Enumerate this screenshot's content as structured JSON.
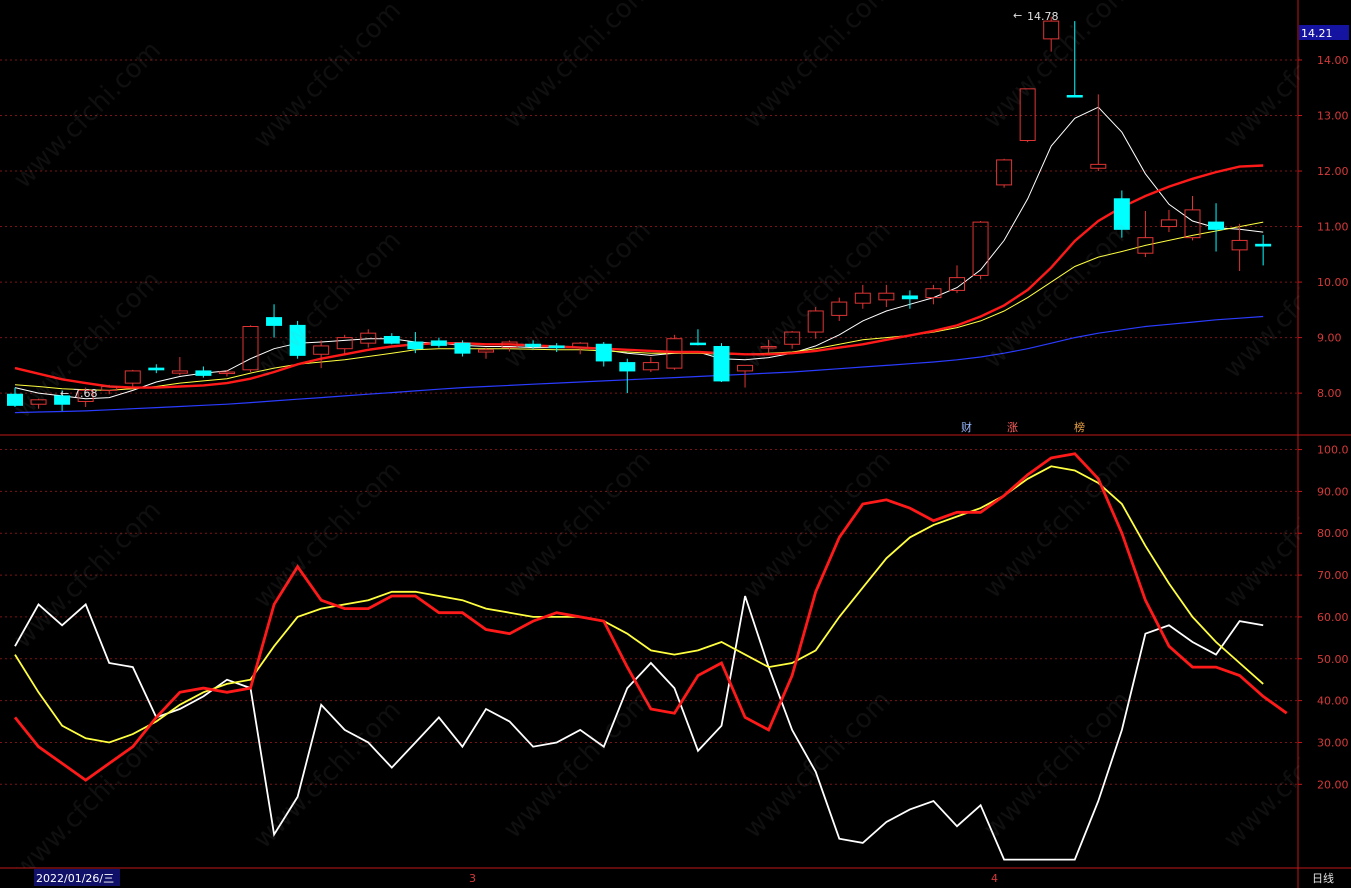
{
  "watermark": "www.cfchi.com",
  "colors": {
    "up": "#e03434",
    "down": "#00ffff",
    "grid": "#7a1414",
    "frame": "#c01818",
    "axis_text": "#d43a3a",
    "ma5": "#ffffff",
    "ma10": "#ffff40",
    "ma20": "#ff1a1a",
    "ma60": "#2a3cff"
  },
  "price_panel": {
    "current_price_tag": "14.21",
    "high_marker": "14.78",
    "low_marker": "7.68",
    "y_ticks": [
      "14.00",
      "13.00",
      "12.00",
      "11.00",
      "10.00",
      "9.00",
      "8.00"
    ],
    "events": [
      {
        "label": "财",
        "color": "#9ab8ff"
      },
      {
        "label": "涨",
        "color": "#ff6060"
      },
      {
        "label": "榜",
        "color": "#e8a040"
      }
    ]
  },
  "indicator_panel": {
    "y_ticks": [
      "100.0",
      "90.00",
      "80.00",
      "70.00",
      "60.00",
      "50.00",
      "40.00",
      "30.00",
      "20.00"
    ]
  },
  "footer": {
    "date_label": "2022/01/26/三",
    "month_marks": [
      "3",
      "4"
    ],
    "period_label": "日线"
  },
  "chart_data": [
    {
      "type": "candlestick",
      "ylim": [
        7.3,
        14.9
      ],
      "candles": [
        {
          "o": 7.98,
          "h": 8.1,
          "l": 7.75,
          "c": 7.78
        },
        {
          "o": 7.8,
          "h": 7.9,
          "l": 7.72,
          "c": 7.88
        },
        {
          "o": 7.95,
          "h": 8.05,
          "l": 7.68,
          "c": 7.8
        },
        {
          "o": 7.85,
          "h": 8.1,
          "l": 7.75,
          "c": 8.05
        },
        {
          "o": 8.05,
          "h": 8.15,
          "l": 7.98,
          "c": 8.12
        },
        {
          "o": 8.18,
          "h": 8.42,
          "l": 8.1,
          "c": 8.4
        },
        {
          "o": 8.45,
          "h": 8.52,
          "l": 8.36,
          "c": 8.42
        },
        {
          "o": 8.36,
          "h": 8.65,
          "l": 8.32,
          "c": 8.4
        },
        {
          "o": 8.4,
          "h": 8.48,
          "l": 8.28,
          "c": 8.32
        },
        {
          "o": 8.36,
          "h": 8.42,
          "l": 8.3,
          "c": 8.38
        },
        {
          "o": 8.42,
          "h": 9.22,
          "l": 8.38,
          "c": 9.2
        },
        {
          "o": 9.36,
          "h": 9.6,
          "l": 9.0,
          "c": 9.22
        },
        {
          "o": 9.22,
          "h": 9.3,
          "l": 8.62,
          "c": 8.68
        },
        {
          "o": 8.7,
          "h": 8.95,
          "l": 8.45,
          "c": 8.85
        },
        {
          "o": 8.8,
          "h": 9.05,
          "l": 8.7,
          "c": 9.0
        },
        {
          "o": 8.9,
          "h": 9.15,
          "l": 8.82,
          "c": 9.08
        },
        {
          "o": 9.02,
          "h": 9.08,
          "l": 8.88,
          "c": 8.9
        },
        {
          "o": 8.92,
          "h": 9.1,
          "l": 8.72,
          "c": 8.8
        },
        {
          "o": 8.94,
          "h": 9.0,
          "l": 8.82,
          "c": 8.86
        },
        {
          "o": 8.9,
          "h": 8.95,
          "l": 8.66,
          "c": 8.72
        },
        {
          "o": 8.74,
          "h": 8.82,
          "l": 8.62,
          "c": 8.78
        },
        {
          "o": 8.82,
          "h": 8.95,
          "l": 8.75,
          "c": 8.92
        },
        {
          "o": 8.88,
          "h": 8.95,
          "l": 8.8,
          "c": 8.84
        },
        {
          "o": 8.85,
          "h": 8.9,
          "l": 8.74,
          "c": 8.82
        },
        {
          "o": 8.82,
          "h": 8.92,
          "l": 8.7,
          "c": 8.9
        },
        {
          "o": 8.88,
          "h": 8.92,
          "l": 8.48,
          "c": 8.58
        },
        {
          "o": 8.55,
          "h": 8.62,
          "l": 8.0,
          "c": 8.4
        },
        {
          "o": 8.42,
          "h": 8.65,
          "l": 8.38,
          "c": 8.55
        },
        {
          "o": 8.45,
          "h": 9.05,
          "l": 8.42,
          "c": 8.98
        },
        {
          "o": 8.9,
          "h": 9.15,
          "l": 8.86,
          "c": 8.88
        },
        {
          "o": 8.84,
          "h": 8.9,
          "l": 8.2,
          "c": 8.22
        },
        {
          "o": 8.4,
          "h": 8.5,
          "l": 8.1,
          "c": 8.5
        },
        {
          "o": 8.82,
          "h": 8.96,
          "l": 8.7,
          "c": 8.84
        },
        {
          "o": 8.88,
          "h": 9.12,
          "l": 8.8,
          "c": 9.1
        },
        {
          "o": 9.1,
          "h": 9.55,
          "l": 8.98,
          "c": 9.48
        },
        {
          "o": 9.4,
          "h": 9.72,
          "l": 9.3,
          "c": 9.64
        },
        {
          "o": 9.62,
          "h": 9.95,
          "l": 9.52,
          "c": 9.8
        },
        {
          "o": 9.68,
          "h": 9.95,
          "l": 9.55,
          "c": 9.8
        },
        {
          "o": 9.75,
          "h": 9.85,
          "l": 9.52,
          "c": 9.7
        },
        {
          "o": 9.72,
          "h": 9.95,
          "l": 9.6,
          "c": 9.88
        },
        {
          "o": 9.85,
          "h": 10.3,
          "l": 9.8,
          "c": 10.08
        },
        {
          "o": 10.12,
          "h": 11.1,
          "l": 10.05,
          "c": 11.08
        },
        {
          "o": 11.75,
          "h": 12.22,
          "l": 11.7,
          "c": 12.2
        },
        {
          "o": 12.55,
          "h": 13.48,
          "l": 12.52,
          "c": 13.48
        },
        {
          "o": 14.38,
          "h": 14.78,
          "l": 14.15,
          "c": 14.7
        },
        {
          "o": 13.36,
          "h": 14.7,
          "l": 13.34,
          "c": 13.34
        },
        {
          "o": 12.05,
          "h": 13.38,
          "l": 12.0,
          "c": 12.12
        },
        {
          "o": 11.5,
          "h": 11.65,
          "l": 10.8,
          "c": 10.95
        },
        {
          "o": 10.52,
          "h": 11.28,
          "l": 10.45,
          "c": 10.8
        },
        {
          "o": 11.0,
          "h": 11.3,
          "l": 10.9,
          "c": 11.12
        },
        {
          "o": 10.8,
          "h": 11.55,
          "l": 10.75,
          "c": 11.3
        },
        {
          "o": 11.08,
          "h": 11.42,
          "l": 10.55,
          "c": 10.95
        },
        {
          "o": 10.58,
          "h": 11.05,
          "l": 10.2,
          "c": 10.75
        },
        {
          "o": 10.68,
          "h": 10.85,
          "l": 10.3,
          "c": 10.65
        }
      ],
      "series": [
        {
          "name": "",
          "color": "#ffffff",
          "values": [
            8.1,
            8.0,
            7.95,
            7.9,
            7.92,
            8.05,
            8.2,
            8.3,
            8.36,
            8.4,
            8.62,
            8.8,
            8.9,
            8.92,
            8.95,
            8.98,
            8.98,
            8.92,
            8.9,
            8.86,
            8.84,
            8.84,
            8.82,
            8.82,
            8.82,
            8.78,
            8.72,
            8.68,
            8.72,
            8.74,
            8.62,
            8.6,
            8.64,
            8.72,
            8.85,
            9.05,
            9.3,
            9.48,
            9.6,
            9.72,
            9.9,
            10.22,
            10.75,
            11.5,
            12.45,
            12.95,
            13.15,
            12.7,
            11.95,
            11.4,
            11.1,
            10.98,
            10.95,
            10.9
          ]
        },
        {
          "name": "",
          "color": "#ffff40",
          "values": [
            8.15,
            8.12,
            8.08,
            8.06,
            8.05,
            8.08,
            8.12,
            8.18,
            8.22,
            8.26,
            8.36,
            8.45,
            8.52,
            8.56,
            8.6,
            8.66,
            8.72,
            8.78,
            8.8,
            8.8,
            8.8,
            8.8,
            8.79,
            8.78,
            8.78,
            8.76,
            8.74,
            8.72,
            8.72,
            8.72,
            8.7,
            8.7,
            8.72,
            8.74,
            8.8,
            8.88,
            8.96,
            9.0,
            9.04,
            9.1,
            9.18,
            9.3,
            9.48,
            9.72,
            10.0,
            10.28,
            10.45,
            10.55,
            10.66,
            10.75,
            10.84,
            10.92,
            11.0,
            11.08
          ]
        },
        {
          "name": "",
          "color": "#ff1a1a",
          "values": [
            8.45,
            8.35,
            8.25,
            8.18,
            8.12,
            8.1,
            8.1,
            8.12,
            8.14,
            8.18,
            8.26,
            8.38,
            8.52,
            8.62,
            8.7,
            8.78,
            8.84,
            8.88,
            8.9,
            8.9,
            8.88,
            8.88,
            8.86,
            8.84,
            8.82,
            8.8,
            8.78,
            8.76,
            8.74,
            8.74,
            8.72,
            8.7,
            8.7,
            8.72,
            8.76,
            8.82,
            8.88,
            8.96,
            9.04,
            9.12,
            9.22,
            9.38,
            9.58,
            9.86,
            10.26,
            10.74,
            11.1,
            11.35,
            11.55,
            11.72,
            11.86,
            11.98,
            12.08,
            12.1
          ]
        },
        {
          "name": "",
          "color": "#2a3cff",
          "values": [
            7.65,
            7.66,
            7.67,
            7.68,
            7.7,
            7.72,
            7.74,
            7.76,
            7.78,
            7.8,
            7.83,
            7.86,
            7.89,
            7.92,
            7.95,
            7.98,
            8.01,
            8.04,
            8.07,
            8.1,
            8.12,
            8.14,
            8.16,
            8.18,
            8.2,
            8.22,
            8.24,
            8.26,
            8.28,
            8.3,
            8.32,
            8.34,
            8.36,
            8.38,
            8.41,
            8.44,
            8.47,
            8.5,
            8.53,
            8.56,
            8.6,
            8.65,
            8.72,
            8.8,
            8.9,
            9.0,
            9.08,
            9.14,
            9.2,
            9.24,
            9.28,
            9.32,
            9.35,
            9.38
          ]
        }
      ]
    },
    {
      "type": "line",
      "ylim": [
        0,
        103
      ],
      "series": [
        {
          "name": "",
          "color": "#ffffff",
          "values": [
            53,
            63,
            58,
            63,
            49,
            48,
            36,
            38,
            41,
            45,
            43,
            8,
            17,
            39,
            33,
            30,
            24,
            30,
            36,
            29,
            38,
            35,
            29,
            30,
            33,
            29,
            43,
            49,
            43,
            28,
            34,
            65,
            48,
            33,
            23,
            7,
            6,
            11,
            14,
            16,
            10,
            15,
            2,
            2,
            2,
            2,
            16,
            33,
            56,
            58,
            54,
            51,
            59,
            58
          ]
        },
        {
          "name": "",
          "color": "#ffff40",
          "values": [
            51,
            42,
            34,
            31,
            30,
            32,
            35,
            39,
            42,
            44,
            45,
            53,
            60,
            62,
            63,
            64,
            66,
            66,
            65,
            64,
            62,
            61,
            60,
            60,
            60,
            59,
            56,
            52,
            51,
            52,
            54,
            51,
            48,
            49,
            52,
            60,
            67,
            74,
            79,
            82,
            84,
            86,
            89,
            93,
            96,
            95,
            92,
            87,
            77,
            68,
            60,
            54,
            49,
            44
          ]
        },
        {
          "name": "",
          "color": "#ff1a1a",
          "values": [
            36,
            29,
            25,
            21,
            25,
            29,
            36,
            42,
            43,
            42,
            43,
            63,
            72,
            64,
            62,
            62,
            65,
            65,
            61,
            61,
            57,
            56,
            59,
            61,
            60,
            59,
            48,
            38,
            37,
            46,
            49,
            36,
            33,
            46,
            66,
            79,
            87,
            88,
            86,
            83,
            85,
            85,
            89,
            94,
            98,
            99,
            93,
            80,
            64,
            53,
            48,
            48,
            46,
            41,
            37
          ]
        }
      ]
    }
  ]
}
